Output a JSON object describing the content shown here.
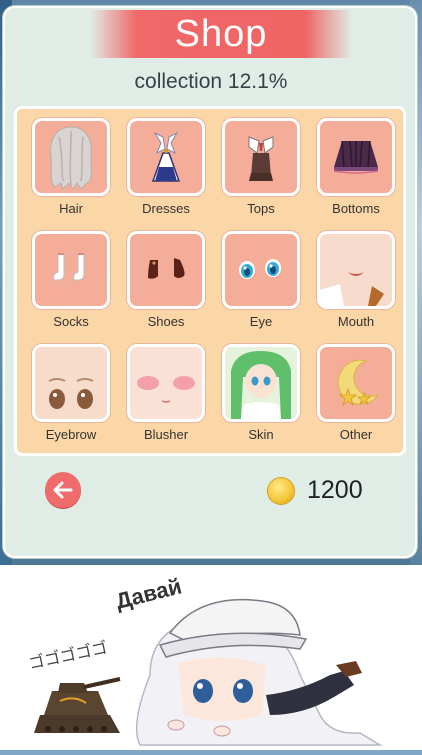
{
  "title": "Shop",
  "collection_label": "collection 12.1%",
  "categories": [
    {
      "label": "Hair",
      "icon": "hair-icon"
    },
    {
      "label": "Dresses",
      "icon": "dress-icon"
    },
    {
      "label": "Tops",
      "icon": "top-icon"
    },
    {
      "label": "Bottoms",
      "icon": "skirt-icon"
    },
    {
      "label": "Socks",
      "icon": "socks-icon"
    },
    {
      "label": "Shoes",
      "icon": "shoes-icon"
    },
    {
      "label": "Eye",
      "icon": "eye-icon"
    },
    {
      "label": "Mouth",
      "icon": "mouth-icon"
    },
    {
      "label": "Eyebrow",
      "icon": "eyebrow-icon"
    },
    {
      "label": "Blusher",
      "icon": "blusher-icon"
    },
    {
      "label": "Skin",
      "icon": "skin-icon"
    },
    {
      "label": "Other",
      "icon": "moon-stars-icon"
    }
  ],
  "coins": "1200",
  "banner_text": "Давай",
  "banner_sfx": "ゴゴゴゴゴ",
  "colors": {
    "title_banner": "#f06868",
    "panel": "#e0ece6",
    "grid_bg": "#fbd6a6",
    "tile": "#f3ad99",
    "back_button": "#f06b6b",
    "coin": "#f5c83a"
  }
}
